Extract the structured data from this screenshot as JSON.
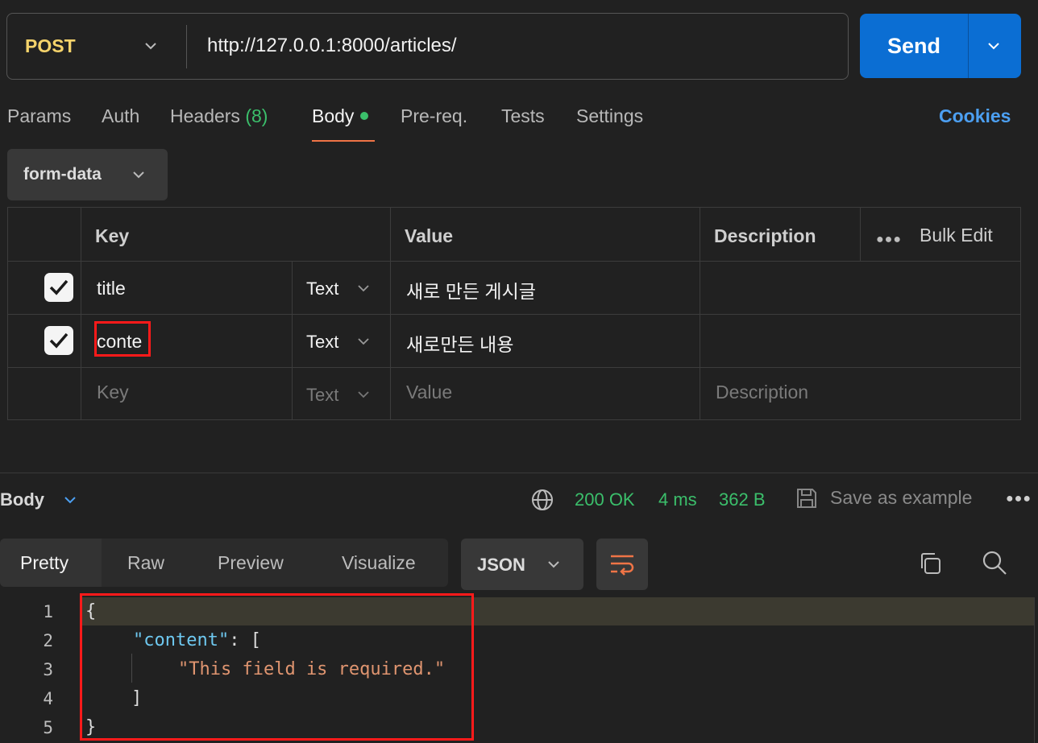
{
  "request": {
    "method": "POST",
    "url": "http://127.0.0.1:8000/articles/",
    "send_label": "Send"
  },
  "tabs": {
    "params": "Params",
    "auth": "Auth",
    "headers": "Headers",
    "headers_count": "(8)",
    "body": "Body",
    "prereq": "Pre-req.",
    "tests": "Tests",
    "settings": "Settings",
    "cookies": "Cookies",
    "active": "Body"
  },
  "body_type": "form-data",
  "table": {
    "headers": {
      "key": "Key",
      "value": "Value",
      "description": "Description",
      "bulk_edit": "Bulk Edit"
    },
    "rows": [
      {
        "checked": true,
        "key": "title",
        "type": "Text",
        "value": "새로 만든 게시글",
        "description": ""
      },
      {
        "checked": true,
        "key": "conte",
        "type": "Text",
        "value": "새로만든 내용",
        "description": ""
      }
    ],
    "empty_row": {
      "key": "Key",
      "type": "Text",
      "value": "Value",
      "description": "Description"
    }
  },
  "response": {
    "section_label": "Body",
    "status": "200 OK",
    "time": "4 ms",
    "size": "362 B",
    "save_example": "Save as example",
    "view_tabs": [
      "Pretty",
      "Raw",
      "Preview",
      "Visualize"
    ],
    "active_view": "Pretty",
    "format": "JSON",
    "code_lines": [
      {
        "number": "1",
        "text": "{"
      },
      {
        "number": "2",
        "key": "\"content\"",
        "rest": ": ["
      },
      {
        "number": "3",
        "str": "\"This field is required.\""
      },
      {
        "number": "4",
        "text": "]"
      },
      {
        "number": "5",
        "text": "}"
      }
    ]
  },
  "colors": {
    "background": "#212121",
    "send_button": "#0b6ed3",
    "method": "#f5d36b",
    "status_ok": "#3bbf6b",
    "cookies_link": "#4c9ff1",
    "active_tab_underline": "#ef7446",
    "annotation_box": "#ff1a1a"
  }
}
